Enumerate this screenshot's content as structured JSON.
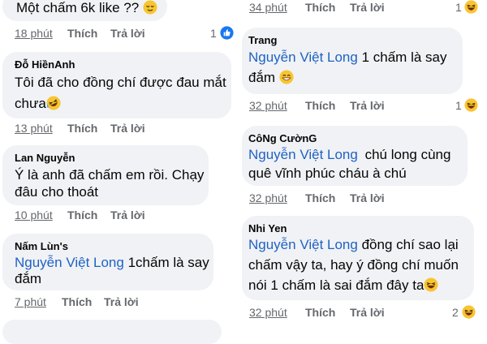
{
  "left": {
    "c0": {
      "line1": "Một chấm 6k like ??",
      "time": "18 phút",
      "like": "Thích",
      "reply": "Trả lời",
      "reactions": "1",
      "reaction_icon": "like-icon"
    },
    "c1": {
      "author": "Đỗ HiềnAnh",
      "line1": "Tôi đã cho đồng chí được đau mắt",
      "line2": "chưa",
      "time": "13 phút",
      "like": "Thích",
      "reply": "Trả lời"
    },
    "c2": {
      "author": "Lan Nguyễn",
      "line1": "Ý là anh đã chấm em rồi. Chạy",
      "line2": "đâu cho thoát",
      "time": "10 phút",
      "like": "Thích",
      "reply": "Trả lời"
    },
    "c3": {
      "author": "Nấm Lùn's",
      "mention": "Nguyễn Việt Long",
      "line1_rest": "1chấm là say",
      "line2": "đắm",
      "time": "7 phút",
      "like": "Thích",
      "reply": "Trả lời"
    }
  },
  "right": {
    "c0": {
      "time": "34 phút",
      "like": "Thích",
      "reply": "Trả lời",
      "reactions": "1",
      "reaction_icon": "laugh-icon"
    },
    "c1": {
      "author": "Trang",
      "mention": "Nguyễn Việt Long",
      "line1_rest": "1 chấm là say",
      "line2": "đắm",
      "time": "32 phút",
      "like": "Thích",
      "reply": "Trả lời",
      "reactions": "1",
      "reaction_icon": "laugh-icon"
    },
    "c2": {
      "author": "CôNg CườnG",
      "mention": "Nguyễn Việt Long",
      "line1_rest": "chú long cùng",
      "line2": "quê vĩnh phúc cháu à chú",
      "time": "32 phút",
      "like": "Thích",
      "reply": "Trả lời"
    },
    "c3": {
      "author": "Nhi Yen",
      "mention": "Nguyễn Việt Long",
      "line1_rest": "đồng chí sao lại",
      "line2": "chấm vậy ta, hay ý đồng chí muốn",
      "line3": "nói 1 chấm là sai đắm đây ta",
      "time": "32 phút",
      "like": "Thích",
      "reply": "Trả lời",
      "reactions": "2",
      "reaction_icon": "laugh-icon"
    }
  },
  "colors": {
    "bubble": "#f0f2f5",
    "mention": "#1f62c4",
    "meta": "#65676b",
    "like_blue": "#1877f2",
    "emoji_yellow": "#f7c531"
  }
}
